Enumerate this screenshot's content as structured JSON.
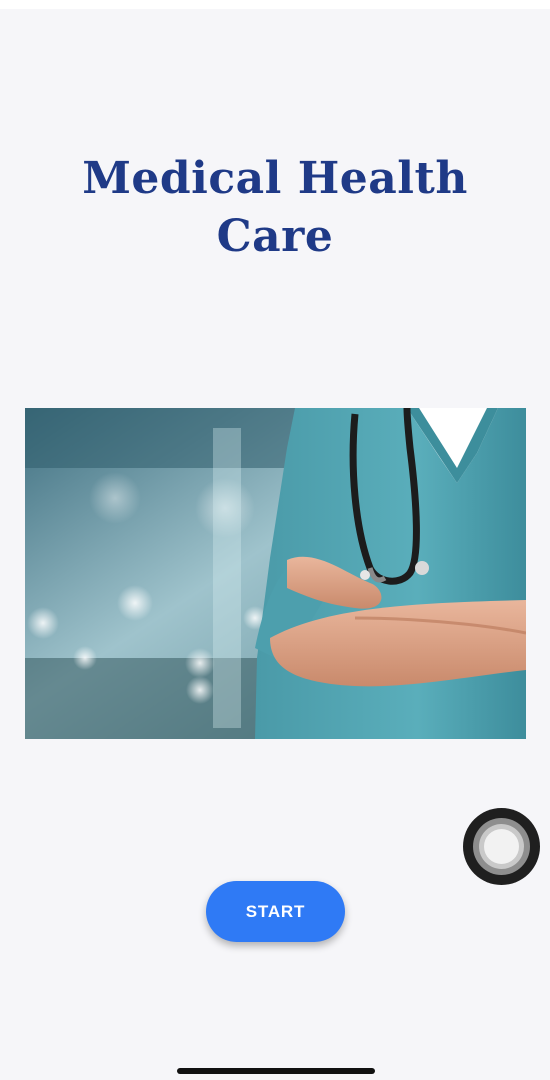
{
  "app": {
    "title": "Medical Health Care",
    "title_line1": "Medical Health",
    "title_line2": "Care"
  },
  "hero_image": {
    "description_icon": "doctor-photo",
    "alt": ""
  },
  "actions": {
    "start_label": "START"
  },
  "colors": {
    "background": "#f6f6f9",
    "title": "#1f3a87",
    "button": "#2f7af5",
    "button_text": "#ffffff"
  },
  "overlay": {
    "assistive_touch_icon": "assistive-touch-icon"
  }
}
